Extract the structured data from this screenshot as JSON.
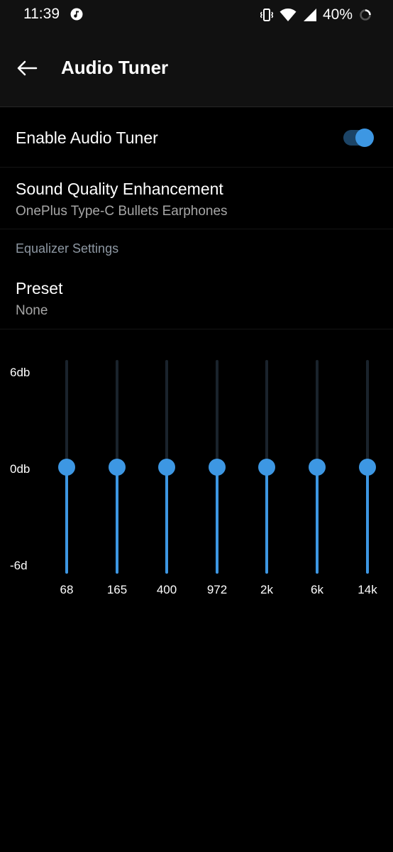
{
  "status_bar": {
    "time": "11:39",
    "battery": "40%",
    "icons": [
      "music-note-icon",
      "vibrate-icon",
      "wifi-icon",
      "signal-icon",
      "battery-charging-icon"
    ]
  },
  "toolbar": {
    "title": "Audio Tuner",
    "back_icon": "arrow-left-icon"
  },
  "settings": {
    "enable_label": "Enable Audio Tuner",
    "enable_on": true,
    "sound_quality_title": "Sound Quality Enhancement",
    "sound_quality_sub": "OnePlus Type-C Bullets Earphones",
    "equalizer_header": "Equalizer Settings",
    "preset_title": "Preset",
    "preset_value": "None"
  },
  "equalizer": {
    "db_labels": [
      "6db",
      "0db",
      "-6d"
    ],
    "max_db": 6,
    "min_db": -6,
    "bands": [
      {
        "freq": "68",
        "db": 0
      },
      {
        "freq": "165",
        "db": 0
      },
      {
        "freq": "400",
        "db": 0
      },
      {
        "freq": "972",
        "db": 0
      },
      {
        "freq": "2k",
        "db": 0
      },
      {
        "freq": "6k",
        "db": 0
      },
      {
        "freq": "14k",
        "db": 0
      }
    ]
  },
  "colors": {
    "accent": "#3d97e3",
    "background": "#000000",
    "toolbar": "#111111",
    "secondary_text": "#a6a6a6"
  }
}
